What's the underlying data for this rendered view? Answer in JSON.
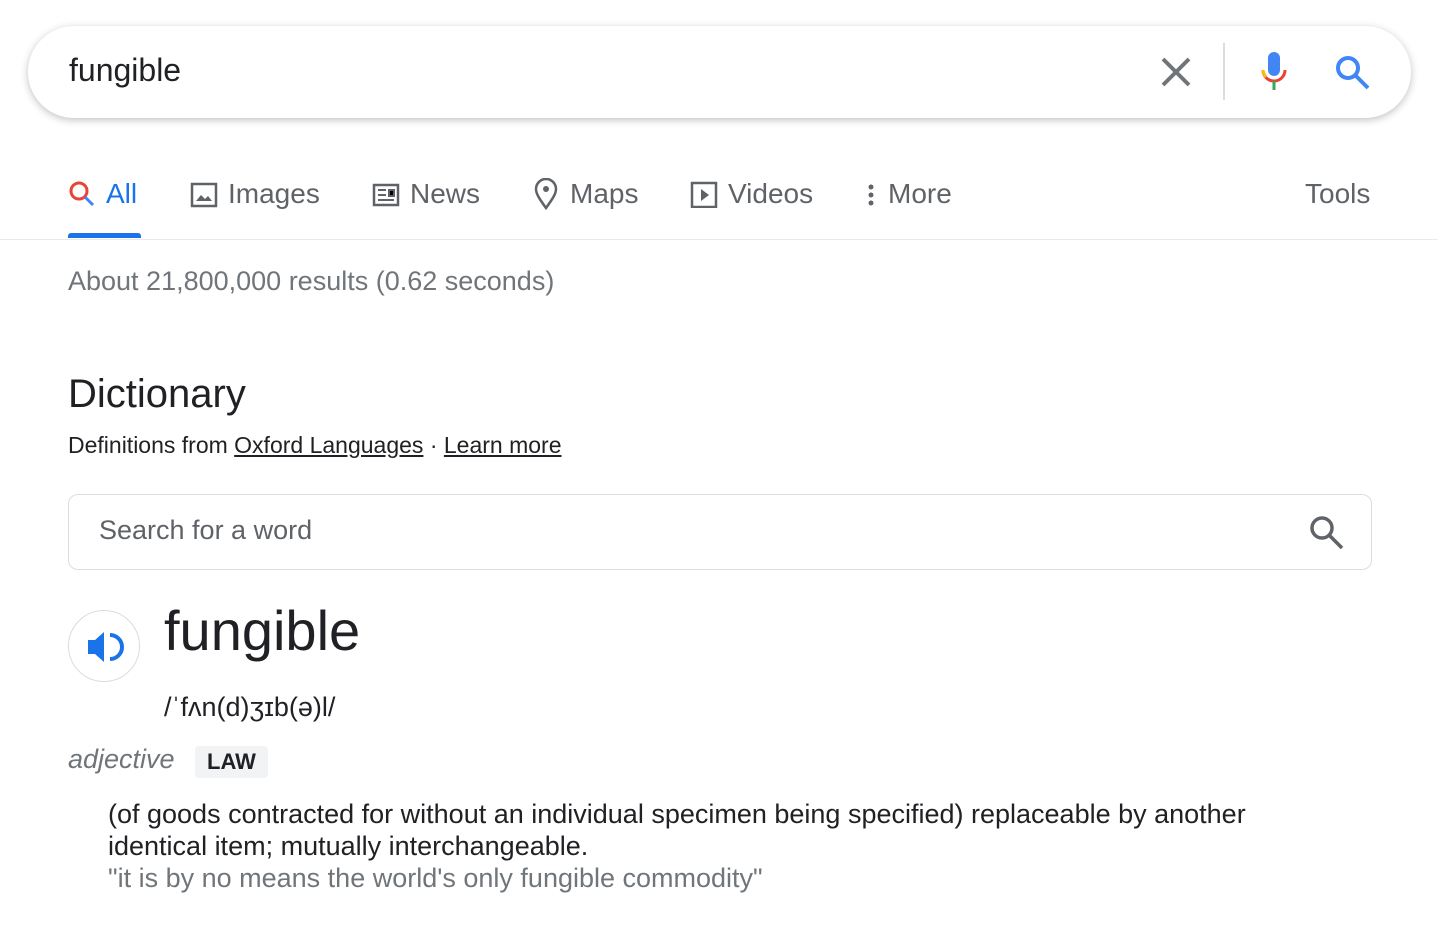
{
  "search": {
    "query": "fungible"
  },
  "tabs": [
    {
      "label": "All",
      "icon": "search-icon"
    },
    {
      "label": "Images",
      "icon": "image-icon"
    },
    {
      "label": "News",
      "icon": "news-icon"
    },
    {
      "label": "Maps",
      "icon": "map-pin-icon"
    },
    {
      "label": "Videos",
      "icon": "play-icon"
    },
    {
      "label": "More",
      "icon": "more-vert-icon"
    }
  ],
  "tools_label": "Tools",
  "stats": "About 21,800,000 results (0.62 seconds)",
  "dictionary": {
    "title": "Dictionary",
    "from": "Definitions from",
    "source": "Oxford Languages",
    "sep": "·",
    "learn_more": "Learn more",
    "search_placeholder": "Search for a word",
    "word": "fungible",
    "pronunciation": "/ˈfʌn(d)ʒɪb(ə)l/",
    "part_of_speech": "adjective",
    "label": "LAW",
    "definition": "(of goods contracted for without an individual specimen being specified) replaceable by another identical item; mutually interchangeable.",
    "example": "\"it is by no means the world's only fungible commodity\""
  },
  "colors": {
    "accent": "#1a73e8",
    "gray": "#70757a"
  }
}
